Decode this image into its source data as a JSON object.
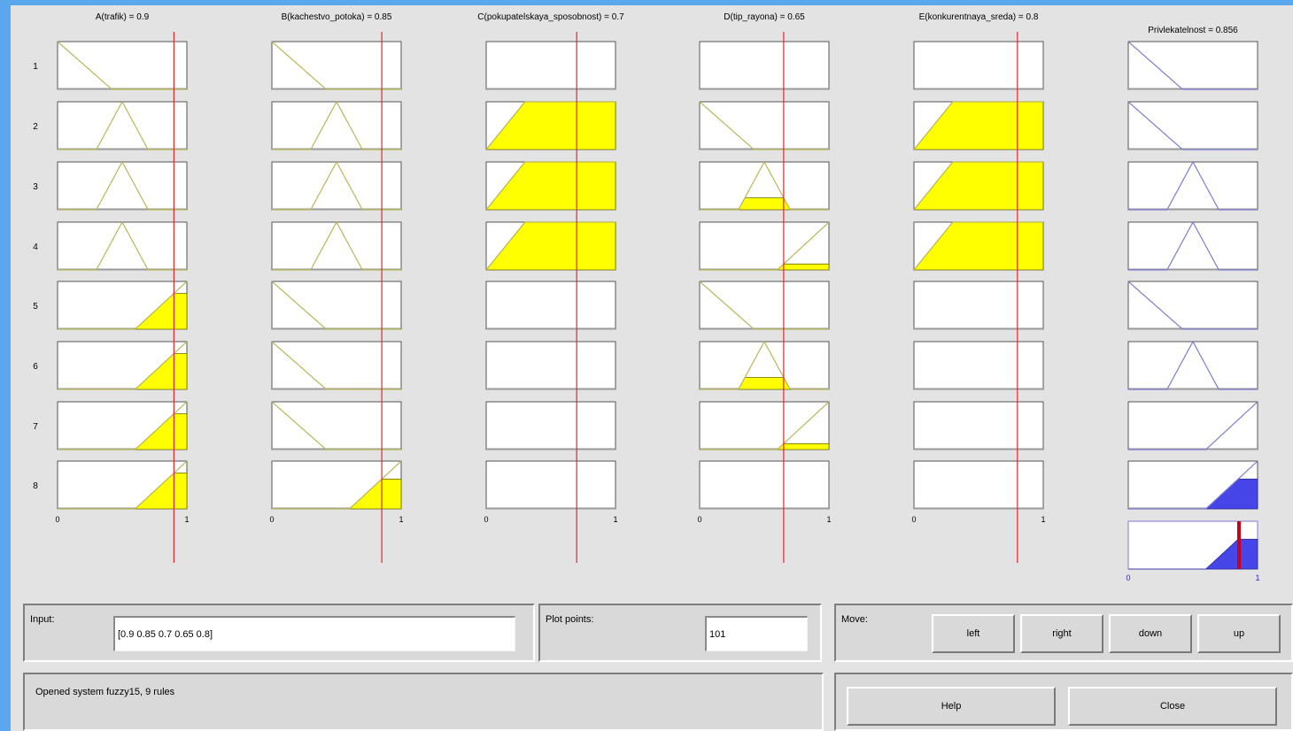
{
  "inputs": [
    {
      "label": "A(trafik) = 0.9"
    },
    {
      "label": "B(kachestvo_potoka) = 0.85"
    },
    {
      "label": "C(pokupatelskaya_sposobnost) = 0.7"
    },
    {
      "label": "D(tip_rayona) = 0.65"
    },
    {
      "label": "E(konkurentnaya_sreda) = 0.8"
    }
  ],
  "output": {
    "label": "Privlekatelnost = 0.856"
  },
  "rule_numbers": [
    "1",
    "2",
    "3",
    "4",
    "5",
    "6",
    "7",
    "8"
  ],
  "axis_ticks": {
    "min": "0",
    "max": "1"
  },
  "input_values": [
    0.9,
    0.85,
    0.7,
    0.65,
    0.8
  ],
  "output_value": 0.856,
  "rule_mfs": [
    [
      "zmf",
      "zmf",
      "none",
      "none",
      "none",
      "zmf"
    ],
    [
      "trimf",
      "trimf",
      "trapmf",
      "zmf",
      "trapmf",
      "zmf"
    ],
    [
      "trimf",
      "trimf",
      "trapmf",
      "trimf",
      "trapmf",
      "trimf"
    ],
    [
      "trimf",
      "trimf",
      "trapmf",
      "smf",
      "trapmf",
      "trimf"
    ],
    [
      "smf",
      "zmf",
      "none",
      "zmf",
      "none",
      "zmf"
    ],
    [
      "smf",
      "zmf",
      "none",
      "trimf",
      "none",
      "trimf"
    ],
    [
      "smf",
      "zmf",
      "none",
      "smf",
      "none",
      "smf"
    ],
    [
      "smf",
      "smf",
      "none",
      "none",
      "none",
      "smf"
    ]
  ],
  "colors": {
    "input_fill": "#ffff00",
    "input_line": "#b7b759",
    "output_fill": "#4646e8",
    "output_line": "#7b7bd0",
    "cursor_line": "#e2272f",
    "defuzz_marker": "#c80018"
  },
  "input_panel": {
    "label": "Input:",
    "value": "[0.9 0.85 0.7 0.65 0.8]"
  },
  "plot_points": {
    "label": "Plot points:",
    "value": "101"
  },
  "move": {
    "label": "Move:",
    "left": "left",
    "right": "right",
    "down": "down",
    "up": "up"
  },
  "status": "Opened system fuzzy15, 9 rules",
  "help_label": "Help",
  "close_label": "Close"
}
